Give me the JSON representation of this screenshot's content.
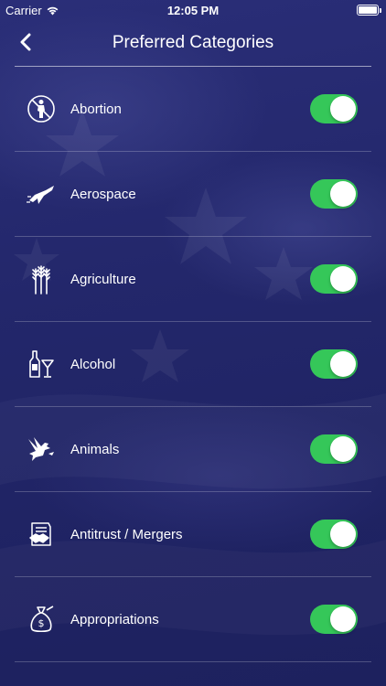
{
  "status_bar": {
    "carrier": "Carrier",
    "time": "12:05 PM"
  },
  "header": {
    "title": "Preferred Categories",
    "back_icon": "chevron-left-icon"
  },
  "categories": [
    {
      "label": "Abortion",
      "icon": "pregnancy-icon",
      "enabled": true
    },
    {
      "label": "Aerospace",
      "icon": "jet-icon",
      "enabled": true
    },
    {
      "label": "Agriculture",
      "icon": "wheat-icon",
      "enabled": true
    },
    {
      "label": "Alcohol",
      "icon": "bottle-glass-icon",
      "enabled": true
    },
    {
      "label": "Animals",
      "icon": "dove-icon",
      "enabled": true
    },
    {
      "label": "Antitrust / Mergers",
      "icon": "handshake-document-icon",
      "enabled": true
    },
    {
      "label": "Appropriations",
      "icon": "money-bag-icon",
      "enabled": true
    }
  ],
  "colors": {
    "background": "#26296e",
    "toggle_on": "#35c759",
    "text": "#ffffff"
  }
}
